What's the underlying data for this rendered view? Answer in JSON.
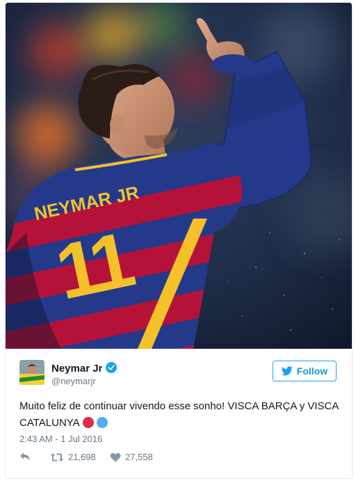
{
  "tweet": {
    "author_name": "Neymar Jr",
    "author_handle": "@neymarjr",
    "verified_icon": "verified-badge-icon",
    "follow_label": "Follow",
    "text": "Muito feliz de continuar vivendo esse sonho! VISCA BARÇA y VISCA CATALUNYA",
    "emoji": [
      "red-circle",
      "blue-circle"
    ],
    "timestamp": "2:43 AM - 1 Jul 2016",
    "retweet_count": "21,698",
    "like_count": "27,558"
  },
  "photo": {
    "jersey_name": "NEYMAR JR",
    "jersey_number": "11"
  },
  "colors": {
    "accent": "#1da1f2",
    "text": "#14171a",
    "secondary_text": "#657786",
    "border": "#e1e8ed",
    "emoji_red": "#dd2e44",
    "emoji_blue": "#55acee",
    "jersey_blue": "#243a8a",
    "jersey_red": "#b5123a",
    "jersey_gold": "#f4c12a"
  }
}
